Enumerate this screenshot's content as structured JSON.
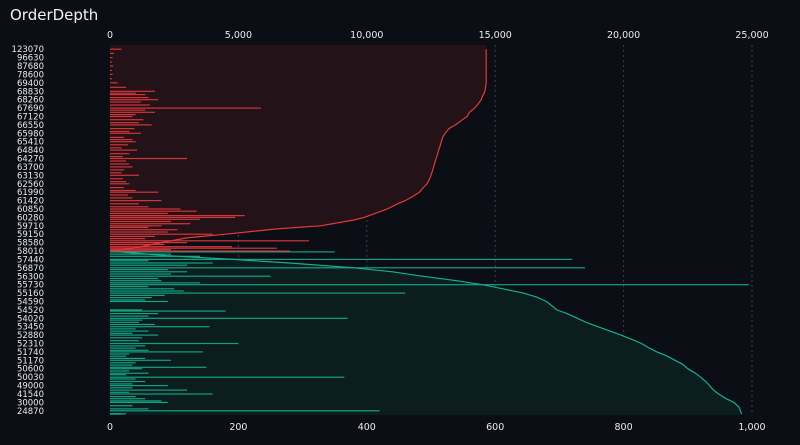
{
  "panel": {
    "title": "OrderDepth"
  },
  "colors": {
    "background": "#0b0e14",
    "ask": "#e5383b",
    "ask_fill": "#231318",
    "bid": "#12b08f",
    "bid_fill": "#0b1d1d",
    "grid": "#3a3f4a",
    "text": "#e6e9ef"
  },
  "chart_data": [
    {
      "type": "area",
      "title": "",
      "description_axis": "top",
      "xlim": [
        0,
        25000
      ],
      "x_ticks": [
        0,
        5000,
        10000,
        15000,
        20000,
        25000
      ],
      "x_tick_labels": [
        "0",
        "5,000",
        "10,000",
        "15,000",
        "20,000",
        "25,000"
      ],
      "y_tick_labels": [
        "123070",
        "96630",
        "87680",
        "78600",
        "69400",
        "68830",
        "68260",
        "67690",
        "67120",
        "66550",
        "65980",
        "65410",
        "64840",
        "64270",
        "63700",
        "63130",
        "62560",
        "61990",
        "61420",
        "60850",
        "60280",
        "59710",
        "59150",
        "58580",
        "58010",
        "57440",
        "56870",
        "56300",
        "55730",
        "55160",
        "54590",
        "54520",
        "54020",
        "53450",
        "52880",
        "52310",
        "51740",
        "51170",
        "50600",
        "50030",
        "49000",
        "41540",
        "30000",
        "24870"
      ],
      "series": [
        {
          "side": "ask",
          "cumulative": [
            [
              58010,
              0
            ],
            [
              58200,
              900
            ],
            [
              58580,
              2000
            ],
            [
              58900,
              3000
            ],
            [
              59150,
              4500
            ],
            [
              59500,
              6500
            ],
            [
              59710,
              8200
            ],
            [
              60100,
              9500
            ],
            [
              60280,
              9900
            ],
            [
              60600,
              10400
            ],
            [
              60850,
              10800
            ],
            [
              61200,
              11200
            ],
            [
              61420,
              11500
            ],
            [
              61700,
              11800
            ],
            [
              61990,
              12050
            ],
            [
              62300,
              12200
            ],
            [
              62560,
              12350
            ],
            [
              62900,
              12450
            ],
            [
              63130,
              12500
            ],
            [
              63400,
              12550
            ],
            [
              63700,
              12600
            ],
            [
              64000,
              12650
            ],
            [
              64270,
              12700
            ],
            [
              64600,
              12760
            ],
            [
              64840,
              12800
            ],
            [
              65100,
              12850
            ],
            [
              65410,
              12900
            ],
            [
              65700,
              12950
            ],
            [
              65980,
              13050
            ],
            [
              66300,
              13200
            ],
            [
              66550,
              13450
            ],
            [
              66800,
              13650
            ],
            [
              67120,
              13900
            ],
            [
              67400,
              14000
            ],
            [
              67690,
              14200
            ],
            [
              68000,
              14350
            ],
            [
              68260,
              14450
            ],
            [
              68550,
              14520
            ],
            [
              68830,
              14600
            ],
            [
              69400,
              14650
            ],
            [
              78600,
              14650
            ],
            [
              87680,
              14650
            ],
            [
              96630,
              14650
            ],
            [
              123070,
              14650
            ]
          ]
        },
        {
          "side": "bid",
          "cumulative": [
            [
              58010,
              0
            ],
            [
              57700,
              2200
            ],
            [
              57440,
              4800
            ],
            [
              57200,
              7000
            ],
            [
              56870,
              9500
            ],
            [
              56600,
              11000
            ],
            [
              56300,
              12200
            ],
            [
              56000,
              13500
            ],
            [
              55730,
              14500
            ],
            [
              55450,
              15300
            ],
            [
              55160,
              16100
            ],
            [
              54900,
              16600
            ],
            [
              54590,
              17000
            ],
            [
              54520,
              17400
            ],
            [
              54300,
              17800
            ],
            [
              54020,
              18200
            ],
            [
              53700,
              18600
            ],
            [
              53450,
              19000
            ],
            [
              53200,
              19400
            ],
            [
              52880,
              19900
            ],
            [
              52600,
              20300
            ],
            [
              52310,
              20700
            ],
            [
              52000,
              21000
            ],
            [
              51740,
              21300
            ],
            [
              51450,
              21700
            ],
            [
              51170,
              22000
            ],
            [
              50900,
              22300
            ],
            [
              50600,
              22500
            ],
            [
              50300,
              22800
            ],
            [
              50030,
              23000
            ],
            [
              49500,
              23200
            ],
            [
              49000,
              23350
            ],
            [
              45000,
              23500
            ],
            [
              41540,
              23700
            ],
            [
              35000,
              24000
            ],
            [
              30000,
              24300
            ],
            [
              27000,
              24500
            ],
            [
              24870,
              24550
            ],
            [
              20000,
              24600
            ],
            [
              10000,
              24600
            ]
          ]
        }
      ]
    },
    {
      "type": "bar",
      "title": "",
      "description_axis": "bottom",
      "xlim": [
        0,
        1000
      ],
      "x_ticks": [
        0,
        200,
        400,
        600,
        800,
        1000
      ],
      "x_tick_labels": [
        "0",
        "200",
        "400",
        "600",
        "800",
        "1,000"
      ],
      "orientation": "horizontal",
      "series": [
        {
          "side": "ask",
          "order_sizes": [
            [
              123070,
              18
            ],
            [
              110000,
              6
            ],
            [
              96630,
              4
            ],
            [
              92000,
              3
            ],
            [
              87680,
              5
            ],
            [
              83000,
              3
            ],
            [
              78600,
              4
            ],
            [
              74000,
              3
            ],
            [
              69400,
              12
            ],
            [
              69100,
              25
            ],
            [
              68830,
              70
            ],
            [
              68700,
              40
            ],
            [
              68600,
              55
            ],
            [
              68400,
              60
            ],
            [
              68260,
              75
            ],
            [
              68100,
              48
            ],
            [
              67900,
              62
            ],
            [
              67690,
              235
            ],
            [
              67550,
              55
            ],
            [
              67400,
              70
            ],
            [
              67250,
              40
            ],
            [
              67120,
              35
            ],
            [
              66900,
              52
            ],
            [
              66700,
              45
            ],
            [
              66550,
              65
            ],
            [
              66300,
              38
            ],
            [
              66100,
              30
            ],
            [
              65980,
              48
            ],
            [
              65700,
              22
            ],
            [
              65550,
              35
            ],
            [
              65410,
              40
            ],
            [
              65200,
              28
            ],
            [
              65000,
              18
            ],
            [
              64840,
              42
            ],
            [
              64600,
              30
            ],
            [
              64400,
              20
            ],
            [
              64270,
              120
            ],
            [
              64100,
              25
            ],
            [
              63900,
              30
            ],
            [
              63700,
              35
            ],
            [
              63500,
              22
            ],
            [
              63300,
              18
            ],
            [
              63130,
              45
            ],
            [
              62900,
              20
            ],
            [
              62700,
              25
            ],
            [
              62560,
              30
            ],
            [
              62300,
              22
            ],
            [
              62100,
              40
            ],
            [
              61990,
              75
            ],
            [
              61800,
              28
            ],
            [
              61600,
              35
            ],
            [
              61420,
              80
            ],
            [
              61200,
              45
            ],
            [
              61000,
              60
            ],
            [
              60850,
              110
            ],
            [
              60700,
              135
            ],
            [
              60550,
              90
            ],
            [
              60400,
              210
            ],
            [
              60280,
              195
            ],
            [
              60150,
              140
            ],
            [
              60000,
              95
            ],
            [
              59850,
              125
            ],
            [
              59710,
              80
            ],
            [
              59600,
              60
            ],
            [
              59450,
              105
            ],
            [
              59300,
              90
            ],
            [
              59150,
              160
            ],
            [
              59000,
              70
            ],
            [
              58850,
              55
            ],
            [
              58700,
              310
            ],
            [
              58580,
              120
            ],
            [
              58450,
              85
            ],
            [
              58300,
              190
            ],
            [
              58200,
              260
            ],
            [
              58100,
              95
            ]
          ]
        },
        {
          "side": "bid",
          "order_sizes": [
            [
              57950,
              350
            ],
            [
              57800,
              95
            ],
            [
              57650,
              140
            ],
            [
              57440,
              720
            ],
            [
              57350,
              60
            ],
            [
              57200,
              160
            ],
            [
              57050,
              120
            ],
            [
              56870,
              740
            ],
            [
              56750,
              90
            ],
            [
              56600,
              120
            ],
            [
              56450,
              95
            ],
            [
              56300,
              250
            ],
            [
              56150,
              75
            ],
            [
              56000,
              80
            ],
            [
              55850,
              140
            ],
            [
              55730,
              995
            ],
            [
              55600,
              60
            ],
            [
              55450,
              100
            ],
            [
              55300,
              115
            ],
            [
              55160,
              460
            ],
            [
              55000,
              85
            ],
            [
              54850,
              65
            ],
            [
              54700,
              55
            ],
            [
              54590,
              90
            ],
            [
              54520,
              50
            ],
            [
              54450,
              180
            ],
            [
              54300,
              75
            ],
            [
              54150,
              60
            ],
            [
              54020,
              370
            ],
            [
              53900,
              50
            ],
            [
              53750,
              45
            ],
            [
              53600,
              70
            ],
            [
              53450,
              155
            ],
            [
              53300,
              40
            ],
            [
              53150,
              60
            ],
            [
              53000,
              35
            ],
            [
              52880,
              75
            ],
            [
              52700,
              50
            ],
            [
              52500,
              45
            ],
            [
              52310,
              200
            ],
            [
              52150,
              55
            ],
            [
              52000,
              40
            ],
            [
              51850,
              60
            ],
            [
              51740,
              145
            ],
            [
              51600,
              30
            ],
            [
              51450,
              25
            ],
            [
              51300,
              55
            ],
            [
              51170,
              95
            ],
            [
              51000,
              40
            ],
            [
              50850,
              35
            ],
            [
              50700,
              150
            ],
            [
              50600,
              50
            ],
            [
              50450,
              30
            ],
            [
              50300,
              60
            ],
            [
              50200,
              25
            ],
            [
              50030,
              365
            ],
            [
              49800,
              40
            ],
            [
              49500,
              55
            ],
            [
              49200,
              35
            ],
            [
              49000,
              90
            ],
            [
              47000,
              35
            ],
            [
              45000,
              120
            ],
            [
              43000,
              30
            ],
            [
              41540,
              160
            ],
            [
              38000,
              40
            ],
            [
              35000,
              55
            ],
            [
              32000,
              80
            ],
            [
              30000,
              90
            ],
            [
              28000,
              35
            ],
            [
              26000,
              60
            ],
            [
              24870,
              420
            ],
            [
              22000,
              25
            ],
            [
              18000,
              20
            ],
            [
              12000,
              15
            ]
          ]
        }
      ]
    }
  ]
}
